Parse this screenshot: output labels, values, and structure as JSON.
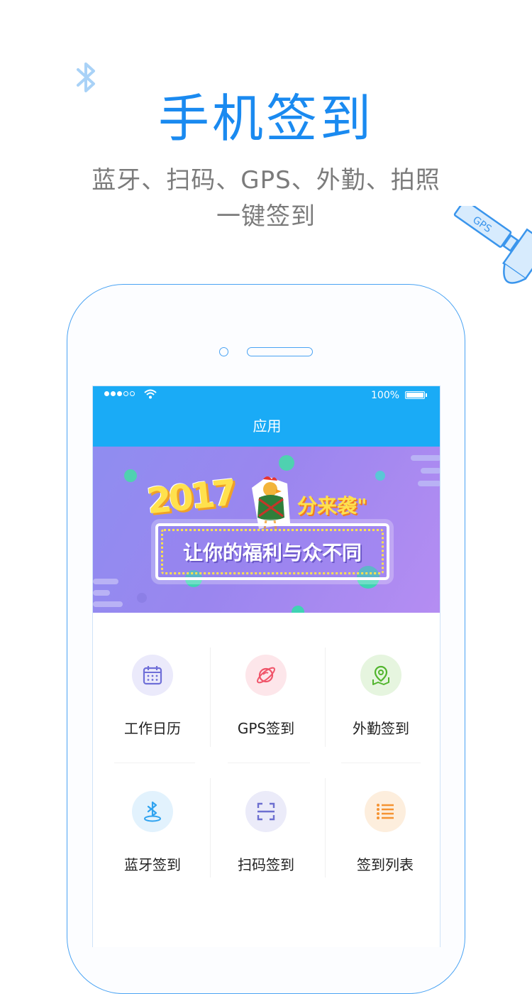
{
  "hero": {
    "title": "手机签到",
    "subtitle_line1": "蓝牙、扫码、GPS、外勤、拍照",
    "subtitle_line2": "一键签到"
  },
  "decorations": {
    "satellite_label": "GPS"
  },
  "status_bar": {
    "battery": "100%",
    "signal_strength_dots": 3,
    "signal_total_dots": 5
  },
  "nav": {
    "title": "应用"
  },
  "banner": {
    "year": "2017",
    "tagline": "分来袭\"",
    "message": "让你的福利与众不同"
  },
  "apps": [
    {
      "label": "工作日历",
      "icon": "calendar-icon",
      "color": "#6f6fd8",
      "bg": "#ebeafb"
    },
    {
      "label": "GPS签到",
      "icon": "planet-icon",
      "color": "#f0556a",
      "bg": "#fde6ea"
    },
    {
      "label": "外勤签到",
      "icon": "map-pin-icon",
      "color": "#52b52e",
      "bg": "#e6f5df"
    },
    {
      "label": "蓝牙签到",
      "icon": "bluetooth-icon",
      "color": "#2fa3f0",
      "bg": "#e2f2fd"
    },
    {
      "label": "扫码签到",
      "icon": "scan-icon",
      "color": "#6d6fd0",
      "bg": "#ebebf9"
    },
    {
      "label": "签到列表",
      "icon": "list-icon",
      "color": "#f59332",
      "bg": "#fdeedd"
    }
  ],
  "colors": {
    "accent": "#1a8af0",
    "nav_bg": "#1aabf6",
    "phone_outline": "#4aa3f3"
  }
}
